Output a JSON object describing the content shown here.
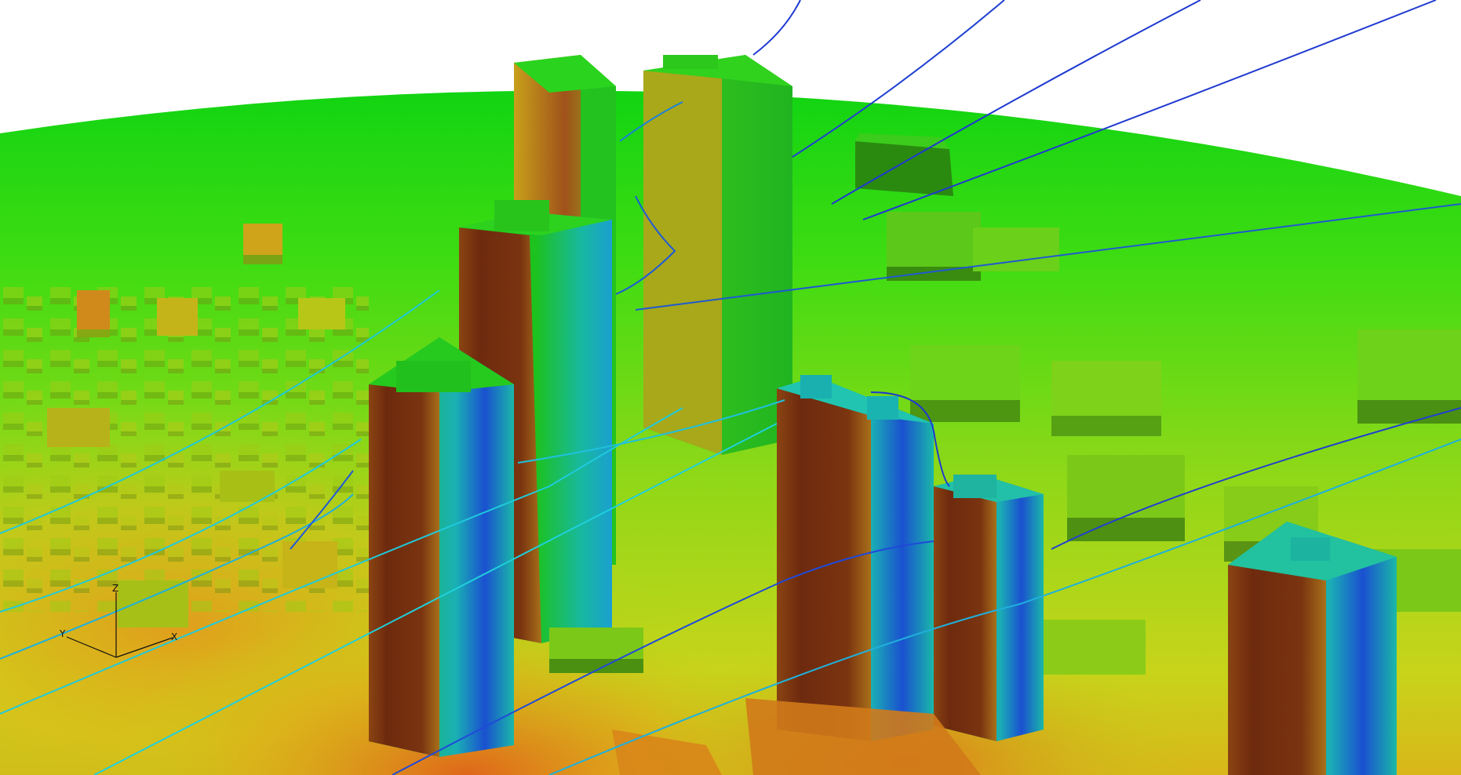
{
  "scene": {
    "axis_triad": {
      "labels": {
        "z": "Z",
        "y": "Y",
        "x": "X"
      }
    },
    "colors": {
      "background": "#ffffff",
      "ground_far": "#0fd40f",
      "ground_mid": "#7fdc12",
      "ground_hot": "#e8c21a",
      "hot": "#d8661c",
      "building_dark": "#7a2c10",
      "building_mid": "#a86a1a",
      "building_green": "#2fc81e",
      "streamline_light": "#1fd0dc",
      "streamline_dark": "#1f2fd0",
      "wake_blue": "#2a6ee0"
    }
  }
}
